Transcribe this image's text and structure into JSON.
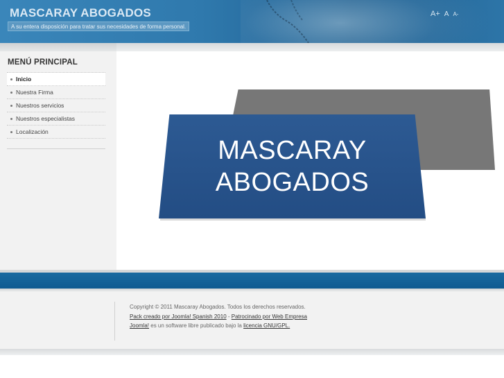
{
  "header": {
    "site_title": "MASCARAY ABOGADOS",
    "slogan": "A su entera disposición para tratar sus necesidades de forma personal.",
    "font_sizer": {
      "increase": "A+",
      "default": "A",
      "decrease": "A-"
    }
  },
  "sidebar": {
    "title": "MENÚ PRINCIPAL",
    "items": [
      {
        "label": "Inicio",
        "active": true
      },
      {
        "label": "Nuestra Firma",
        "active": false
      },
      {
        "label": "Nuestros servicios",
        "active": false
      },
      {
        "label": "Nuestros especialistas",
        "active": false
      },
      {
        "label": "Localización",
        "active": false
      }
    ]
  },
  "main": {
    "logo_line1": "MASCARAY",
    "logo_line2": "ABOGADOS"
  },
  "footer": {
    "copyright": "Copyright © 2011 Mascaray Abogados. Todos los derechos reservados.",
    "pack_link": "Pack creado por Joomla! Spanish 2010",
    "separator": " - ",
    "sponsor_link": "Patrocinado por Web Empresa",
    "joomla_link": "Joomla!",
    "license_text": " es un software libre publicado bajo la ",
    "license_link": "licencia GNU/GPL."
  },
  "colors": {
    "header_blue": "#2f79ad",
    "bar_blue": "#0f5b91",
    "logo_blue": "#2d5a93",
    "logo_gray": "#777777"
  }
}
